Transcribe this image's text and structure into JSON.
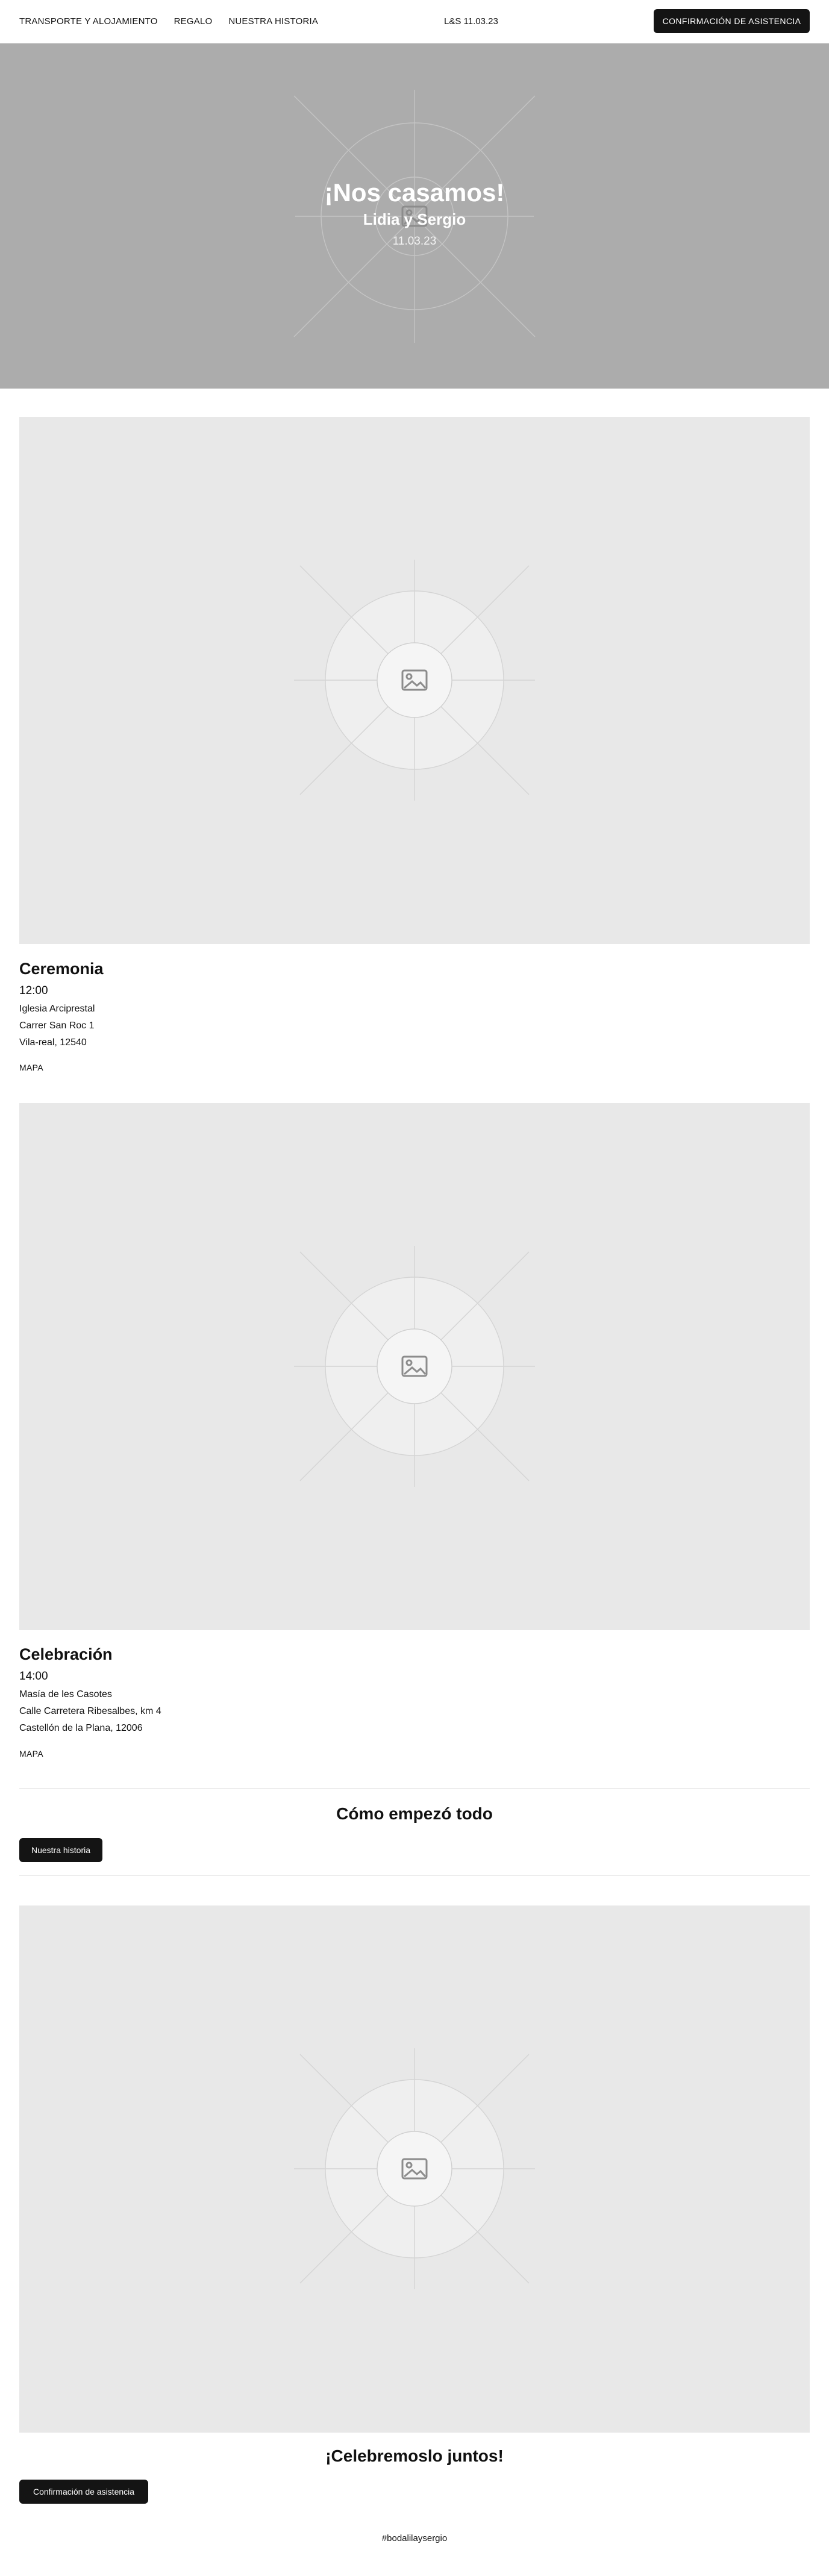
{
  "header": {
    "nav": [
      "TRANSPORTE Y ALOJAMIENTO",
      "REGALO",
      "NUESTRA HISTORIA"
    ],
    "brand": "L&S 11.03.23",
    "rsvp_label": "CONFIRMACIÓN DE ASISTENCIA"
  },
  "hero": {
    "title": "¡Nos casamos!",
    "names": "Lidia y Sergio",
    "date": "11.03.23",
    "image_icon": "image-placeholder-icon"
  },
  "ceremony": {
    "title": "Ceremonia",
    "time": "12:00",
    "address": [
      "Iglesia Arciprestal",
      "Carrer San Roc 1",
      "Vila-real, 12540"
    ],
    "map_label": "MAPA"
  },
  "celebration": {
    "title": "Celebración",
    "time": "14:00",
    "address": [
      "Masía de les Casotes",
      "Calle Carretera Ribesalbes, km 4",
      "Castellón de la Plana, 12006"
    ],
    "map_label": "MAPA"
  },
  "story": {
    "heading": "Cómo empezó todo",
    "button_label": "Nuestra historia"
  },
  "celebrate": {
    "heading": "¡Celebremoslo juntos!",
    "button_label": "Confirmación de asistencia"
  },
  "footer": {
    "hashtag": "#bodalilaysergio"
  },
  "colors": {
    "accent": "#141414",
    "hero_bg": "#acacac",
    "placeholder_bg": "#e8e8e8"
  }
}
